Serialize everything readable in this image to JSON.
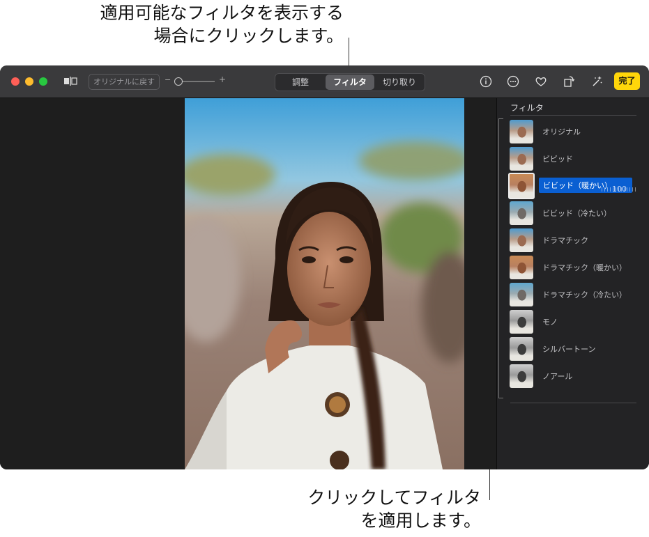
{
  "callouts": {
    "top_line1": "適用可能なフィルタを表示する",
    "top_line2": "場合にクリックします。",
    "bottom_line1": "クリックしてフィルタ",
    "bottom_line2": "を適用します。"
  },
  "toolbar": {
    "revert_label": "オリジナルに戻す",
    "zoom_minus": "−",
    "zoom_plus": "+",
    "tabs": [
      {
        "label": "調整"
      },
      {
        "label": "フィルタ",
        "selected": true
      },
      {
        "label": "切り取り"
      }
    ],
    "done_label": "完了"
  },
  "sidebar": {
    "title": "フィルタ",
    "filters": [
      {
        "label": "オリジナル",
        "tone": "color"
      },
      {
        "label": "ビビッド",
        "tone": "color"
      },
      {
        "label": "ビビッド（暖かい）",
        "tone": "warm",
        "selected": true,
        "amount": "100"
      },
      {
        "label": "ビビッド（冷たい）",
        "tone": "cool"
      },
      {
        "label": "ドラマチック",
        "tone": "color"
      },
      {
        "label": "ドラマチック（暖かい）",
        "tone": "warm"
      },
      {
        "label": "ドラマチック（冷たい）",
        "tone": "cool"
      },
      {
        "label": "モノ",
        "tone": "mono"
      },
      {
        "label": "シルバートーン",
        "tone": "mono"
      },
      {
        "label": "ノアール",
        "tone": "mono"
      }
    ]
  },
  "colors": {
    "accent_selected": "#0a5fd2",
    "done_button": "#ffd60a"
  }
}
